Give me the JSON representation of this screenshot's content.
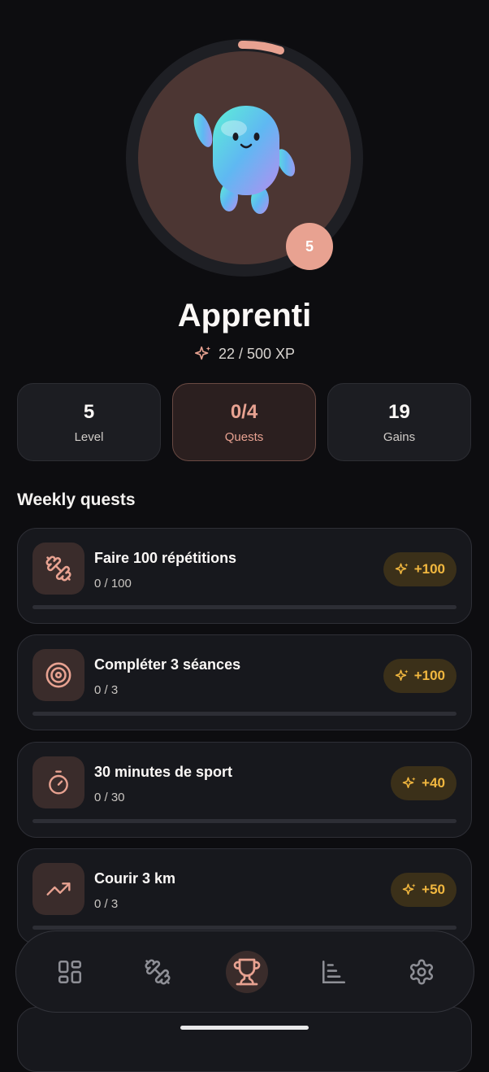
{
  "profile": {
    "rank": "Apprenti",
    "level_badge": "5",
    "xp_text": "22 / 500 XP",
    "xp_current": 22,
    "xp_max": 500
  },
  "stats": [
    {
      "value": "5",
      "label": "Level"
    },
    {
      "value": "0/4",
      "label": "Quests"
    },
    {
      "value": "19",
      "label": "Gains"
    }
  ],
  "section_title": "Weekly quests",
  "quests": [
    {
      "title": "Faire 100 répétitions",
      "progress": "0 / 100",
      "reward": "+100",
      "icon": "dumbbell-icon",
      "fraction": 0
    },
    {
      "title": "Compléter 3 séances",
      "progress": "0 / 3",
      "reward": "+100",
      "icon": "target-icon",
      "fraction": 0
    },
    {
      "title": "30 minutes de sport",
      "progress": "0 / 30",
      "reward": "+40",
      "icon": "stopwatch-icon",
      "fraction": 0
    },
    {
      "title": "Courir 3 km",
      "progress": "0 / 3",
      "reward": "+50",
      "icon": "trending-up-icon",
      "fraction": 0
    }
  ],
  "nav": {
    "items": [
      "dashboard-icon",
      "dumbbell-icon",
      "trophy-icon",
      "chart-icon",
      "gear-icon"
    ],
    "active": "trophy-icon"
  },
  "colors": {
    "accent": "#e8a291",
    "reward": "#f1b73f",
    "background": "#0d0d10",
    "card": "#17181d"
  }
}
